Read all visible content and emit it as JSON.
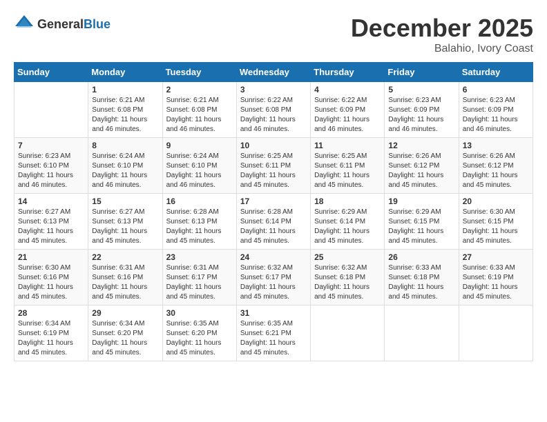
{
  "header": {
    "logo_general": "General",
    "logo_blue": "Blue",
    "month_year": "December 2025",
    "location": "Balahio, Ivory Coast"
  },
  "calendar": {
    "days_of_week": [
      "Sunday",
      "Monday",
      "Tuesday",
      "Wednesday",
      "Thursday",
      "Friday",
      "Saturday"
    ],
    "weeks": [
      [
        {
          "day": "",
          "sunrise": "",
          "sunset": "",
          "daylight": ""
        },
        {
          "day": "1",
          "sunrise": "Sunrise: 6:21 AM",
          "sunset": "Sunset: 6:08 PM",
          "daylight": "Daylight: 11 hours and 46 minutes."
        },
        {
          "day": "2",
          "sunrise": "Sunrise: 6:21 AM",
          "sunset": "Sunset: 6:08 PM",
          "daylight": "Daylight: 11 hours and 46 minutes."
        },
        {
          "day": "3",
          "sunrise": "Sunrise: 6:22 AM",
          "sunset": "Sunset: 6:08 PM",
          "daylight": "Daylight: 11 hours and 46 minutes."
        },
        {
          "day": "4",
          "sunrise": "Sunrise: 6:22 AM",
          "sunset": "Sunset: 6:09 PM",
          "daylight": "Daylight: 11 hours and 46 minutes."
        },
        {
          "day": "5",
          "sunrise": "Sunrise: 6:23 AM",
          "sunset": "Sunset: 6:09 PM",
          "daylight": "Daylight: 11 hours and 46 minutes."
        },
        {
          "day": "6",
          "sunrise": "Sunrise: 6:23 AM",
          "sunset": "Sunset: 6:09 PM",
          "daylight": "Daylight: 11 hours and 46 minutes."
        }
      ],
      [
        {
          "day": "7",
          "sunrise": "Sunrise: 6:23 AM",
          "sunset": "Sunset: 6:10 PM",
          "daylight": "Daylight: 11 hours and 46 minutes."
        },
        {
          "day": "8",
          "sunrise": "Sunrise: 6:24 AM",
          "sunset": "Sunset: 6:10 PM",
          "daylight": "Daylight: 11 hours and 46 minutes."
        },
        {
          "day": "9",
          "sunrise": "Sunrise: 6:24 AM",
          "sunset": "Sunset: 6:10 PM",
          "daylight": "Daylight: 11 hours and 46 minutes."
        },
        {
          "day": "10",
          "sunrise": "Sunrise: 6:25 AM",
          "sunset": "Sunset: 6:11 PM",
          "daylight": "Daylight: 11 hours and 45 minutes."
        },
        {
          "day": "11",
          "sunrise": "Sunrise: 6:25 AM",
          "sunset": "Sunset: 6:11 PM",
          "daylight": "Daylight: 11 hours and 45 minutes."
        },
        {
          "day": "12",
          "sunrise": "Sunrise: 6:26 AM",
          "sunset": "Sunset: 6:12 PM",
          "daylight": "Daylight: 11 hours and 45 minutes."
        },
        {
          "day": "13",
          "sunrise": "Sunrise: 6:26 AM",
          "sunset": "Sunset: 6:12 PM",
          "daylight": "Daylight: 11 hours and 45 minutes."
        }
      ],
      [
        {
          "day": "14",
          "sunrise": "Sunrise: 6:27 AM",
          "sunset": "Sunset: 6:13 PM",
          "daylight": "Daylight: 11 hours and 45 minutes."
        },
        {
          "day": "15",
          "sunrise": "Sunrise: 6:27 AM",
          "sunset": "Sunset: 6:13 PM",
          "daylight": "Daylight: 11 hours and 45 minutes."
        },
        {
          "day": "16",
          "sunrise": "Sunrise: 6:28 AM",
          "sunset": "Sunset: 6:13 PM",
          "daylight": "Daylight: 11 hours and 45 minutes."
        },
        {
          "day": "17",
          "sunrise": "Sunrise: 6:28 AM",
          "sunset": "Sunset: 6:14 PM",
          "daylight": "Daylight: 11 hours and 45 minutes."
        },
        {
          "day": "18",
          "sunrise": "Sunrise: 6:29 AM",
          "sunset": "Sunset: 6:14 PM",
          "daylight": "Daylight: 11 hours and 45 minutes."
        },
        {
          "day": "19",
          "sunrise": "Sunrise: 6:29 AM",
          "sunset": "Sunset: 6:15 PM",
          "daylight": "Daylight: 11 hours and 45 minutes."
        },
        {
          "day": "20",
          "sunrise": "Sunrise: 6:30 AM",
          "sunset": "Sunset: 6:15 PM",
          "daylight": "Daylight: 11 hours and 45 minutes."
        }
      ],
      [
        {
          "day": "21",
          "sunrise": "Sunrise: 6:30 AM",
          "sunset": "Sunset: 6:16 PM",
          "daylight": "Daylight: 11 hours and 45 minutes."
        },
        {
          "day": "22",
          "sunrise": "Sunrise: 6:31 AM",
          "sunset": "Sunset: 6:16 PM",
          "daylight": "Daylight: 11 hours and 45 minutes."
        },
        {
          "day": "23",
          "sunrise": "Sunrise: 6:31 AM",
          "sunset": "Sunset: 6:17 PM",
          "daylight": "Daylight: 11 hours and 45 minutes."
        },
        {
          "day": "24",
          "sunrise": "Sunrise: 6:32 AM",
          "sunset": "Sunset: 6:17 PM",
          "daylight": "Daylight: 11 hours and 45 minutes."
        },
        {
          "day": "25",
          "sunrise": "Sunrise: 6:32 AM",
          "sunset": "Sunset: 6:18 PM",
          "daylight": "Daylight: 11 hours and 45 minutes."
        },
        {
          "day": "26",
          "sunrise": "Sunrise: 6:33 AM",
          "sunset": "Sunset: 6:18 PM",
          "daylight": "Daylight: 11 hours and 45 minutes."
        },
        {
          "day": "27",
          "sunrise": "Sunrise: 6:33 AM",
          "sunset": "Sunset: 6:19 PM",
          "daylight": "Daylight: 11 hours and 45 minutes."
        }
      ],
      [
        {
          "day": "28",
          "sunrise": "Sunrise: 6:34 AM",
          "sunset": "Sunset: 6:19 PM",
          "daylight": "Daylight: 11 hours and 45 minutes."
        },
        {
          "day": "29",
          "sunrise": "Sunrise: 6:34 AM",
          "sunset": "Sunset: 6:20 PM",
          "daylight": "Daylight: 11 hours and 45 minutes."
        },
        {
          "day": "30",
          "sunrise": "Sunrise: 6:35 AM",
          "sunset": "Sunset: 6:20 PM",
          "daylight": "Daylight: 11 hours and 45 minutes."
        },
        {
          "day": "31",
          "sunrise": "Sunrise: 6:35 AM",
          "sunset": "Sunset: 6:21 PM",
          "daylight": "Daylight: 11 hours and 45 minutes."
        },
        {
          "day": "",
          "sunrise": "",
          "sunset": "",
          "daylight": ""
        },
        {
          "day": "",
          "sunrise": "",
          "sunset": "",
          "daylight": ""
        },
        {
          "day": "",
          "sunrise": "",
          "sunset": "",
          "daylight": ""
        }
      ]
    ]
  }
}
